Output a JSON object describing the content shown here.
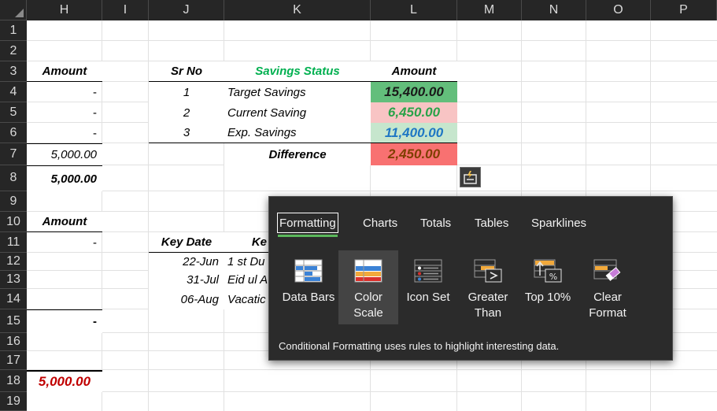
{
  "sheet": {
    "columns": [
      "H",
      "I",
      "J",
      "K",
      "L",
      "M",
      "N",
      "O",
      "P"
    ],
    "rows": [
      "1",
      "2",
      "3",
      "4",
      "5",
      "6",
      "7",
      "8",
      "9",
      "10",
      "11",
      "12",
      "13",
      "14",
      "15",
      "16",
      "17",
      "18",
      "19"
    ]
  },
  "table_left": {
    "header_amount": "Amount",
    "values": [
      "-",
      "-",
      "-",
      "5,000.00"
    ],
    "total": "5,000.00",
    "header_amount_2": "Amount",
    "value_2": "-",
    "value_3": "-",
    "grand_total": "5,000.00"
  },
  "savings_table": {
    "headers": {
      "sr_no": "Sr No",
      "status": "Savings Status",
      "amount": "Amount"
    },
    "rows": [
      {
        "sr": "1",
        "status": "Target Savings",
        "amount": "15,400.00"
      },
      {
        "sr": "2",
        "status": "Current Saving",
        "amount": "6,450.00"
      },
      {
        "sr": "3",
        "status": "Exp. Savings",
        "amount": "11,400.00"
      }
    ],
    "difference_label": "Difference",
    "difference_value": "2,450.00"
  },
  "dates_table": {
    "header_date": "Key Date",
    "header_event": "Ke",
    "rows": [
      {
        "date": "22-Jun",
        "event": "1 st Du"
      },
      {
        "date": "31-Jul",
        "event": "Eid ul A"
      },
      {
        "date": "06-Aug",
        "event": "Vacatic"
      }
    ]
  },
  "colors": {
    "status_header": "#00b050",
    "target_fill": "#63be7b",
    "current_fill": "#f8c4c4",
    "current_text": "#2aa34a",
    "exp_fill": "#c6e6cd",
    "exp_text": "#1f77c4",
    "difference_fill": "#f87171",
    "difference_text": "#7f3f00",
    "grand_total_text": "#c00000",
    "tab_underline": "#5bb75b"
  },
  "quick_analysis": {
    "button_icon": "quick-analysis-icon",
    "tabs": [
      "Formatting",
      "Charts",
      "Totals",
      "Tables",
      "Sparklines"
    ],
    "active_tab": "Formatting",
    "items": [
      {
        "label": "Data Bars",
        "icon": "data-bars-icon"
      },
      {
        "label": "Color Scale",
        "icon": "color-scale-icon"
      },
      {
        "label": "Icon Set",
        "icon": "icon-set-icon"
      },
      {
        "label": "Greater Than",
        "icon": "greater-than-icon"
      },
      {
        "label": "Top 10%",
        "icon": "top-10-percent-icon"
      },
      {
        "label": "Clear Format",
        "icon": "clear-format-icon"
      }
    ],
    "selected_item": "Color Scale",
    "description": "Conditional Formatting uses rules to highlight interesting data."
  }
}
